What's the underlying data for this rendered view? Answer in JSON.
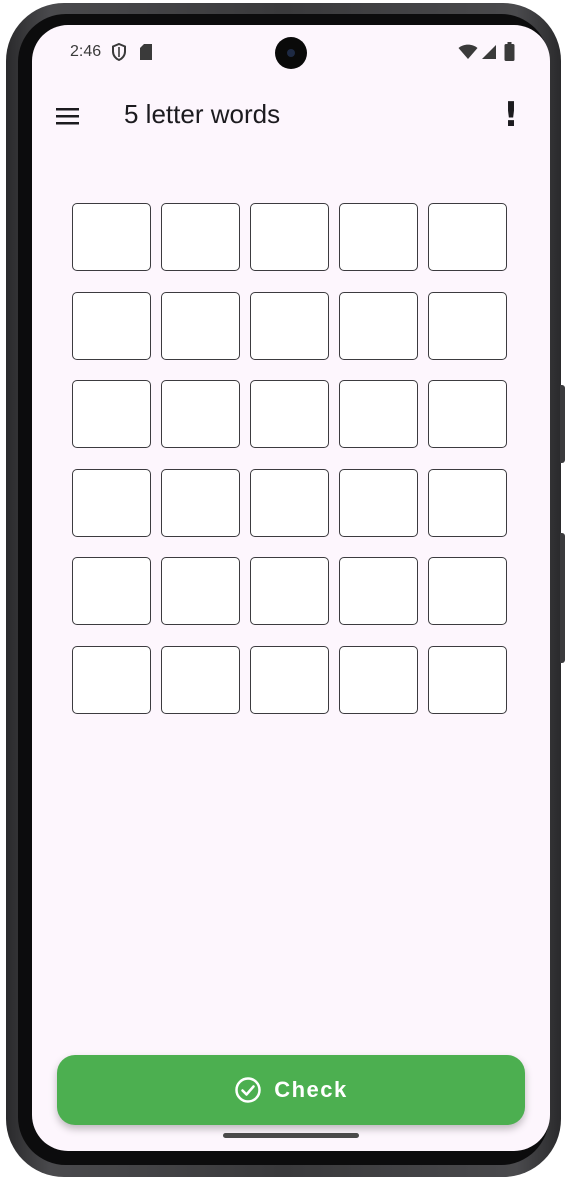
{
  "status_bar": {
    "time": "2:46",
    "left_icons": [
      "shield-icon",
      "sd-card-icon"
    ],
    "right_icons": [
      "wifi-icon",
      "cell-signal-icon",
      "battery-icon"
    ]
  },
  "app_bar": {
    "title": "5 letter words",
    "menu_icon": "hamburger-menu-icon",
    "info_label": "!"
  },
  "grid": {
    "rows": [
      [
        "",
        "",
        "",
        "",
        ""
      ],
      [
        "",
        "",
        "",
        "",
        ""
      ],
      [
        "",
        "",
        "",
        "",
        ""
      ],
      [
        "",
        "",
        "",
        "",
        ""
      ],
      [
        "",
        "",
        "",
        "",
        ""
      ],
      [
        "",
        "",
        "",
        "",
        ""
      ]
    ]
  },
  "check_button": {
    "label": "Check",
    "icon": "check-circle-icon",
    "color": "#4caf50"
  },
  "colors": {
    "background": "#fdf6fd",
    "accent": "#4caf50",
    "cell_border": "#3c3b3f"
  }
}
